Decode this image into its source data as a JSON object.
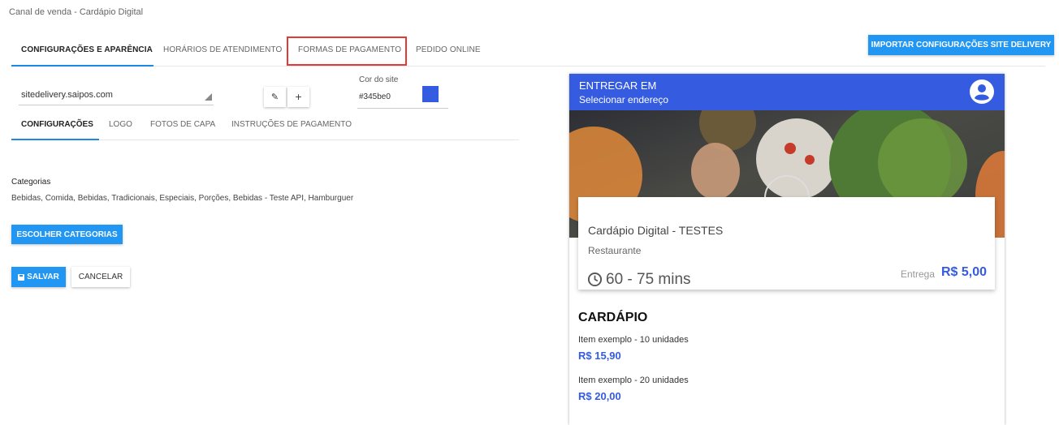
{
  "page": {
    "title": "Canal de venda - Cardápio Digital"
  },
  "main_tabs": [
    {
      "label": "CONFIGURAÇÕES E APARÊNCIA"
    },
    {
      "label": "HORÁRIOS DE ATENDIMENTO"
    },
    {
      "label": "FORMAS DE PAGAMENTO"
    },
    {
      "label": "PEDIDO ONLINE"
    }
  ],
  "import_button": {
    "label": "IMPORTAR CONFIGURAÇÕES SITE DELIVERY"
  },
  "site_select": {
    "value": "sitedelivery.saipos.com"
  },
  "icon_buttons": {
    "edit_glyph": "✎",
    "add_glyph": "+"
  },
  "color": {
    "label": "Cor do site",
    "value": "#345be0"
  },
  "sub_tabs": [
    {
      "label": "CONFIGURAÇÕES"
    },
    {
      "label": "LOGO"
    },
    {
      "label": "FOTOS DE CAPA"
    },
    {
      "label": "INSTRUÇÕES DE PAGAMENTO"
    }
  ],
  "categories": {
    "label": "Categorias",
    "list": "Bebidas, Comida, Bebidas, Tradicionais, Especiais, Porções, Bebidas - Teste API, Hamburguer"
  },
  "buttons": {
    "choose": "ESCOLHER CATEGORIAS",
    "save": "SALVAR",
    "cancel": "CANCELAR"
  },
  "preview": {
    "header": {
      "deliver_label": "ENTREGAR EM",
      "address": "Selecionar endereço"
    },
    "restaurant": {
      "name": "Cardápio Digital - TESTES",
      "type": "Restaurante",
      "time": "60 - 75 mins",
      "delivery_label": "Entrega",
      "delivery_price": "R$ 5,00"
    },
    "menu": {
      "title": "CARDÁPIO",
      "items": [
        {
          "name": "Item exemplo - 10 unidades",
          "price": "R$ 15,90"
        },
        {
          "name": "Item exemplo - 20 unidades",
          "price": "R$ 20,00"
        }
      ]
    }
  },
  "colors": {
    "accent": "#2196f3",
    "brand": "#345be0",
    "highlight": "#e53935"
  }
}
